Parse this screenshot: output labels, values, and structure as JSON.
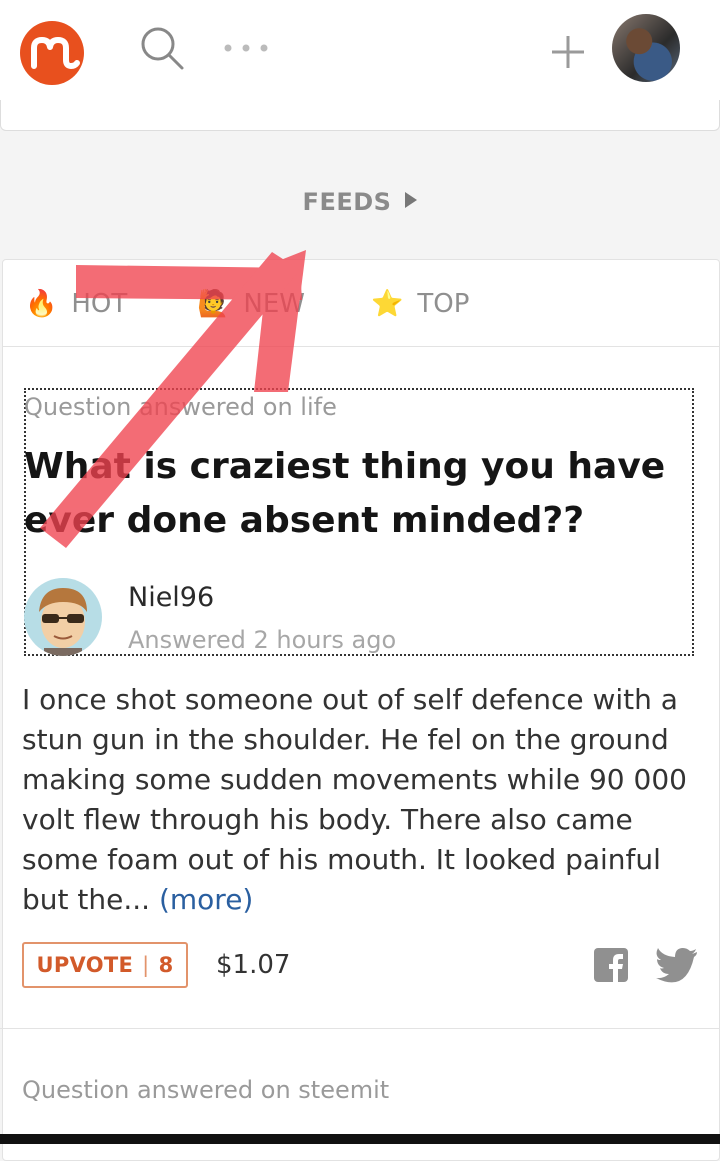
{
  "header": {
    "logo_icon": "steemit-m-logo",
    "search_icon": "search-icon",
    "more_icon": "more-dots-icon",
    "add_icon": "plus-icon",
    "avatar_icon": "user-avatar"
  },
  "feeds": {
    "label": "FEEDS"
  },
  "tabs": [
    {
      "label": "HOT",
      "emoji": "🔥"
    },
    {
      "label": "NEW",
      "emoji": "🙋"
    },
    {
      "label": "TOP",
      "emoji": "⭐"
    }
  ],
  "post": {
    "category": "Question answered on life",
    "title": "What is craziest thing you have ever done absent minded??",
    "author": "Niel96",
    "time": "Answered 2 hours ago",
    "body": "I once shot someone out of self defence with a stun gun in the shoulder. He fel on the ground making some sudden movements while 90 000 volt flew through his body. There also came some foam out of his mouth.  It looked painful but the...",
    "more": "(more)",
    "upvote_label": "UPVOTE",
    "upvote_count": "8",
    "payout": "$1.07"
  },
  "next_post": {
    "category": "Question answered on steemit"
  },
  "colors": {
    "brand": "#e8501e",
    "accent_link": "#2a5fa0",
    "arrow": "#f0434f"
  }
}
